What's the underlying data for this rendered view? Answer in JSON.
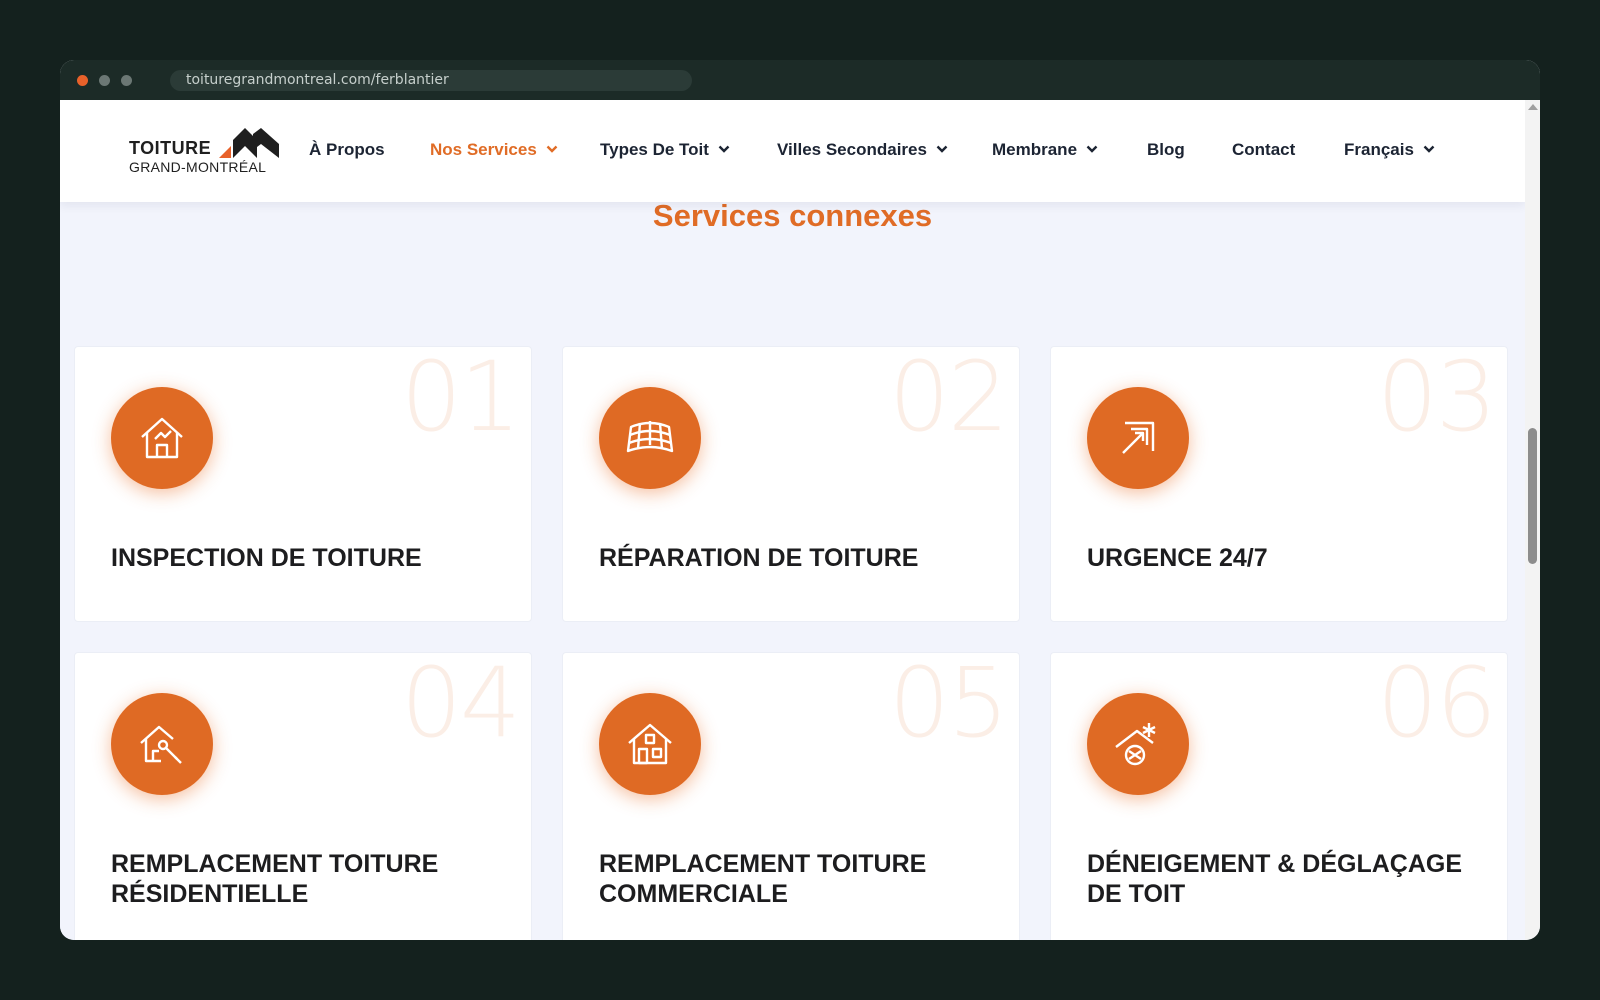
{
  "browser": {
    "url": "toituregrandmontreal.com/ferblantier"
  },
  "header": {
    "logo": {
      "word": "TOITURE",
      "sub": "GRAND-MONTRÉAL"
    },
    "nav": [
      {
        "label": "À Propos",
        "dropdown": false
      },
      {
        "label": "Nos Services",
        "dropdown": true,
        "active": true
      },
      {
        "label": "Types De Toit",
        "dropdown": true
      },
      {
        "label": "Villes Secondaires",
        "dropdown": true
      },
      {
        "label": "Membrane",
        "dropdown": true
      },
      {
        "label": "Blog",
        "dropdown": false
      },
      {
        "label": "Contact",
        "dropdown": false
      },
      {
        "label": "Français",
        "dropdown": true
      }
    ]
  },
  "section": {
    "title": "Services connexes",
    "cards": [
      {
        "num": "01",
        "title": "INSPECTION DE TOITURE",
        "icon": "house-inspection-icon"
      },
      {
        "num": "02",
        "title": "RÉPARATION DE TOITURE",
        "icon": "roof-tiles-icon"
      },
      {
        "num": "03",
        "title": "URGENCE 24/7",
        "icon": "arrow-corner-icon"
      },
      {
        "num": "04",
        "title": "REMPLACEMENT TOITURE RÉSIDENTIELLE",
        "icon": "house-wrench-icon"
      },
      {
        "num": "05",
        "title": "REMPLACEMENT TOITURE COMMERCIALE",
        "icon": "building-icon"
      },
      {
        "num": "06",
        "title": "DÉNEIGEMENT & DÉGLAÇAGE DE TOIT",
        "icon": "snow-roof-icon"
      }
    ]
  },
  "colors": {
    "accent": "#e06c26",
    "text": "#1c2433",
    "background": "#f2f4fc"
  }
}
